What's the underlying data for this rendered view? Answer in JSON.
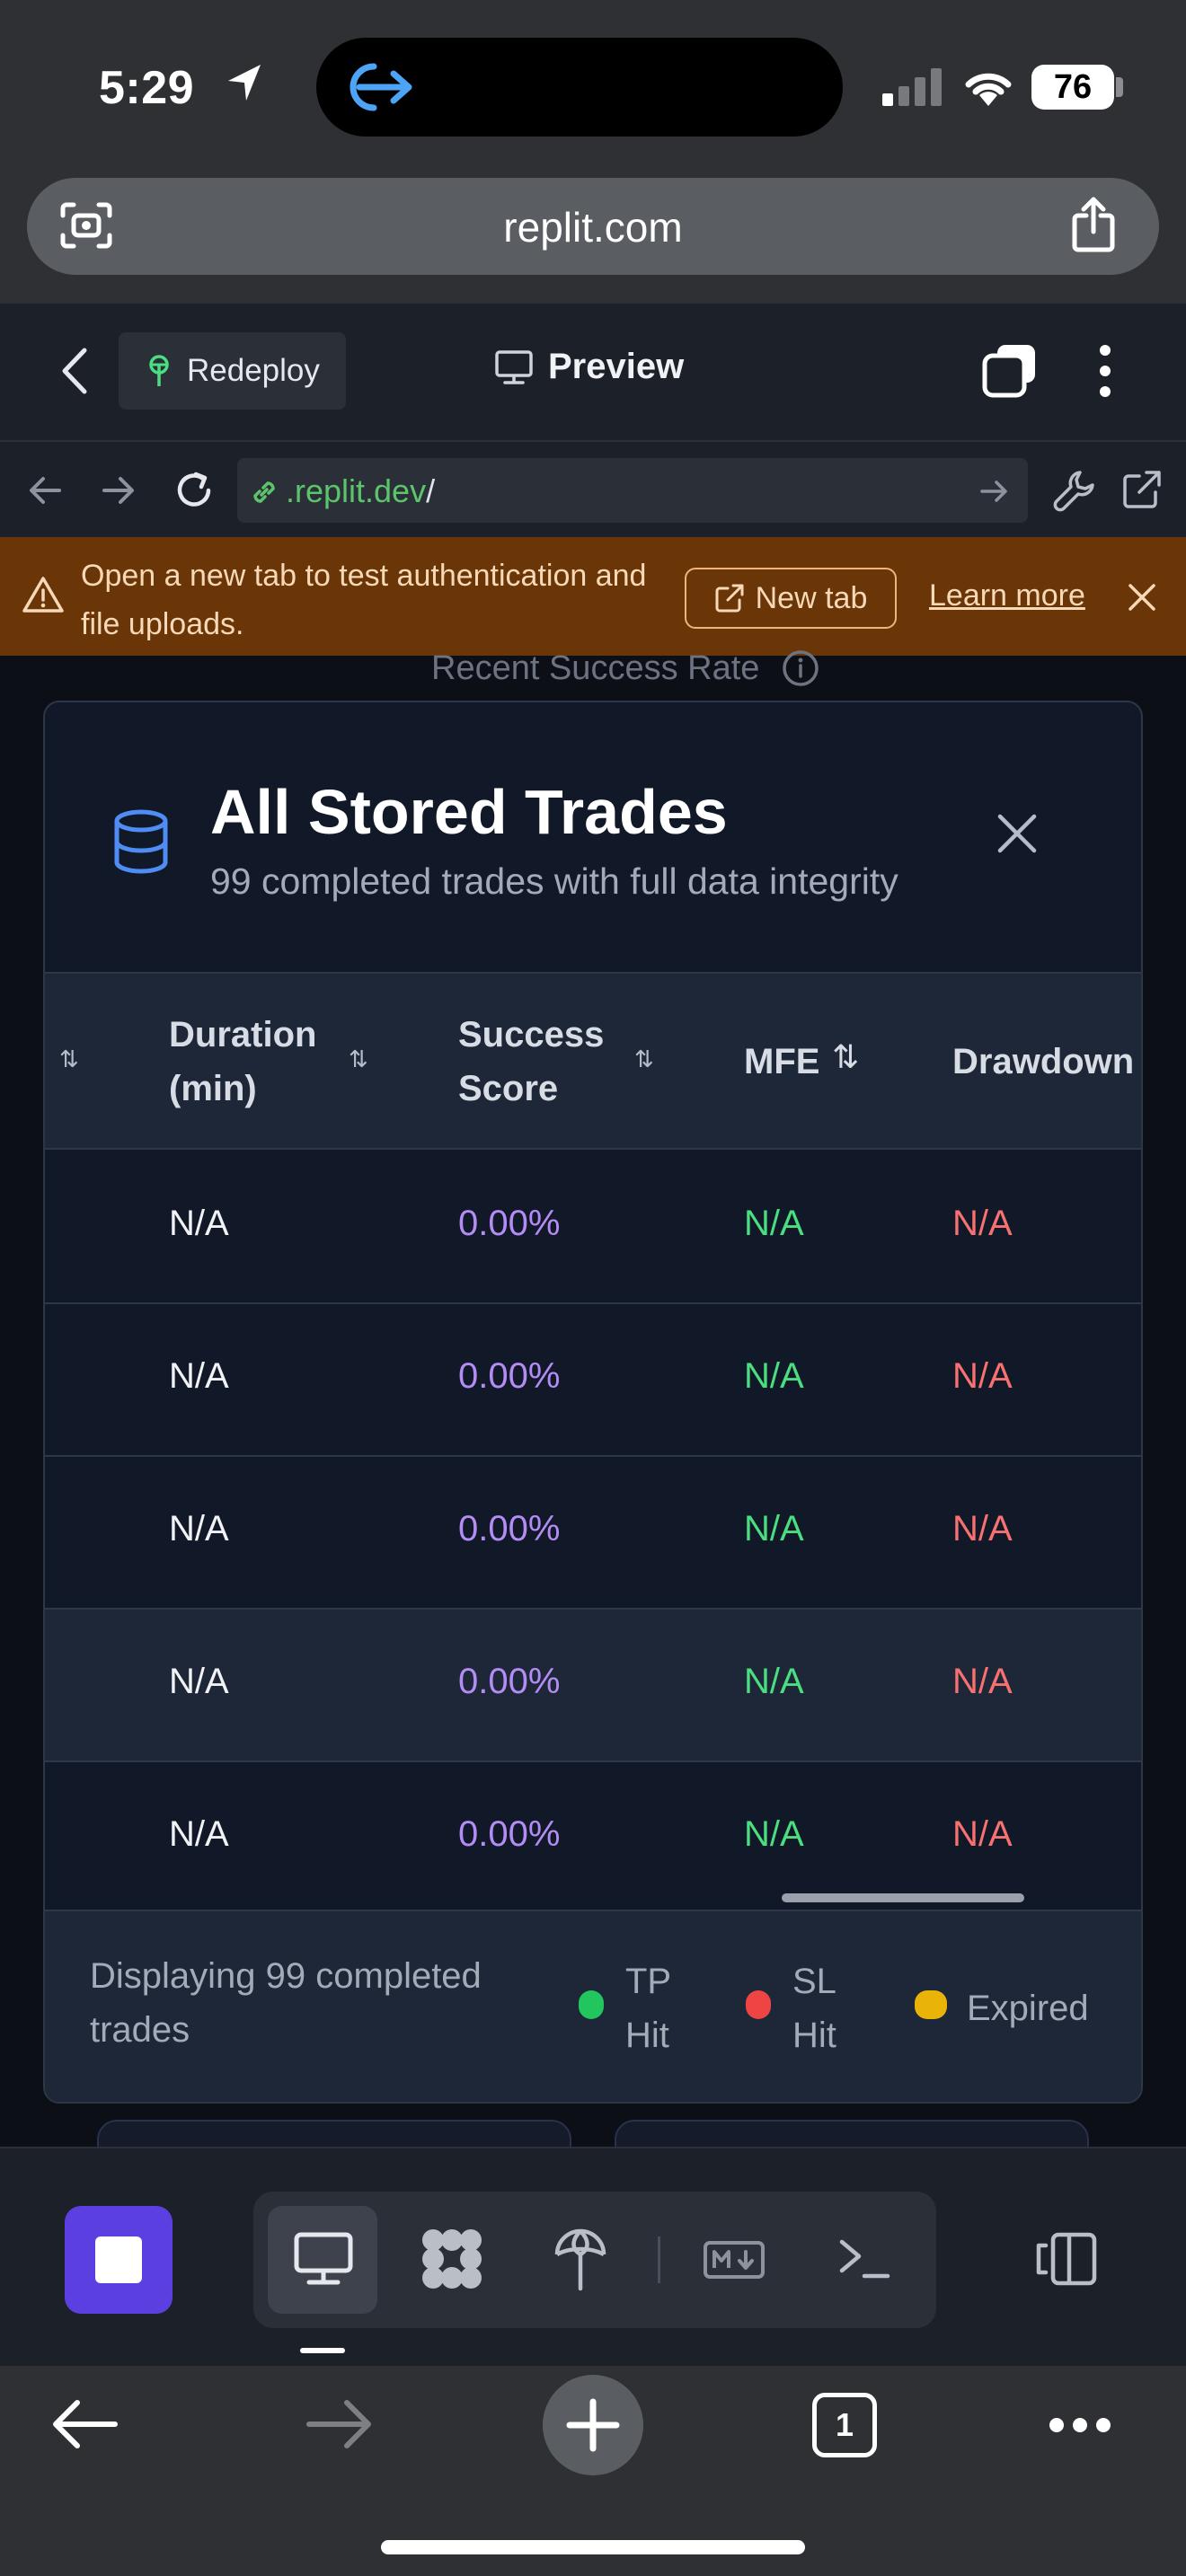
{
  "status_bar": {
    "time": "5:29",
    "battery": "76"
  },
  "safari": {
    "url": "replit.com",
    "tab_count": "1"
  },
  "replit_header": {
    "redeploy_label": "Redeploy",
    "preview_label": "Preview"
  },
  "devtools": {
    "address_domain": ".replit.dev",
    "address_path": "/"
  },
  "banner": {
    "message": "Open a new tab to test authentication and file uploads.",
    "new_tab_label": "New tab",
    "learn_more_label": "Learn more"
  },
  "background": {
    "heading": "Recent Success Rate"
  },
  "modal": {
    "title": "All Stored Trades",
    "subtitle": "99 completed trades with full data integrity",
    "columns": {
      "duration": "Duration (min)",
      "success": "Success Score",
      "mfe": "MFE",
      "drawdown": "Drawdown"
    },
    "rows": [
      {
        "duration": "N/A",
        "success": "0.00%",
        "mfe": "N/A",
        "drawdown": "N/A"
      },
      {
        "duration": "N/A",
        "success": "0.00%",
        "mfe": "N/A",
        "drawdown": "N/A"
      },
      {
        "duration": "N/A",
        "success": "0.00%",
        "mfe": "N/A",
        "drawdown": "N/A"
      },
      {
        "duration": "N/A",
        "success": "0.00%",
        "mfe": "N/A",
        "drawdown": "N/A"
      },
      {
        "duration": "N/A",
        "success": "0.00%",
        "mfe": "N/A",
        "drawdown": "N/A"
      }
    ],
    "footer_text": "Displaying 99 completed trades",
    "legend": [
      {
        "label": "TP Hit",
        "color": "#22c55e"
      },
      {
        "label": "SL Hit",
        "color": "#ef4444"
      },
      {
        "label": "Expired",
        "color": "#eab308"
      }
    ]
  },
  "colors": {
    "accent_purple": "#5b3fe0",
    "success_text": "#b48cf5",
    "mfe_text": "#4ade80",
    "drawdown_text": "#f87171",
    "warning_bg": "#6a3507"
  }
}
